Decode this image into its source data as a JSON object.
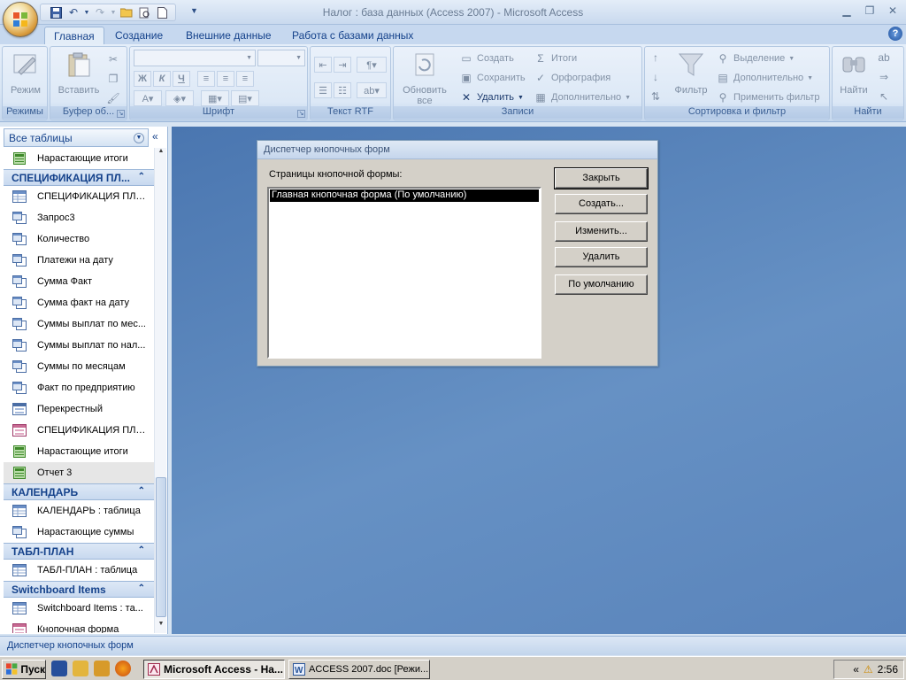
{
  "window": {
    "title": "Налог : база данных (Access 2007) - Microsoft Access"
  },
  "ribbon_tabs": [
    "Главная",
    "Создание",
    "Внешние данные",
    "Работа с базами данных"
  ],
  "ribbon": {
    "groups": {
      "modes": "Режимы",
      "clipboard": "Буфер об...",
      "font": "Шрифт",
      "rtf": "Текст RTF",
      "records": "Записи",
      "sort_filter": "Сортировка и фильтр",
      "find": "Найти"
    },
    "buttons": {
      "view": "Режим",
      "paste": "Вставить",
      "refresh": "Обновить все",
      "new": "Создать",
      "save": "Сохранить",
      "delete": "Удалить",
      "totals": "Итоги",
      "spelling": "Орфография",
      "more": "Дополнительно",
      "filter": "Фильтр",
      "selection": "Выделение",
      "advanced": "Дополнительно",
      "toggle_filter": "Применить фильтр",
      "find": "Найти"
    },
    "format": {
      "bold": "Ж",
      "italic": "К",
      "underline": "Ч"
    }
  },
  "nav": {
    "header": "Все таблицы",
    "top_item": "Нарастающие итоги",
    "groups": [
      {
        "name": "СПЕЦИФИКАЦИЯ ПЛ...",
        "items": [
          {
            "label": "СПЕЦИФИКАЦИЯ ПЛА...",
            "icon": "table-icon"
          },
          {
            "label": "Запрос3",
            "icon": "query-icon"
          },
          {
            "label": "Количество",
            "icon": "query-icon"
          },
          {
            "label": "Платежи на дату",
            "icon": "query-icon"
          },
          {
            "label": "Сумма Факт",
            "icon": "query-icon"
          },
          {
            "label": "Сумма факт на дату",
            "icon": "query-icon"
          },
          {
            "label": "Суммы выплат по мес...",
            "icon": "query-icon"
          },
          {
            "label": "Суммы выплат по нал...",
            "icon": "query-icon"
          },
          {
            "label": "Суммы по месяцам",
            "icon": "query-icon"
          },
          {
            "label": "Факт по предприятию",
            "icon": "query-icon"
          },
          {
            "label": "Перекрестный",
            "icon": "form-icon"
          },
          {
            "label": "СПЕЦИФИКАЦИЯ ПЛА...",
            "icon": "form-icon-pink"
          },
          {
            "label": "Нарастающие итоги",
            "icon": "report-icon"
          },
          {
            "label": "Отчет 3",
            "icon": "report-icon",
            "selected": true
          }
        ]
      },
      {
        "name": "КАЛЕНДАРЬ",
        "items": [
          {
            "label": "КАЛЕНДАРЬ : таблица",
            "icon": "table-icon"
          },
          {
            "label": "Нарастающие суммы",
            "icon": "query-icon"
          }
        ]
      },
      {
        "name": "ТАБЛ-ПЛАН",
        "items": [
          {
            "label": "ТАБЛ-ПЛАН : таблица",
            "icon": "table-icon"
          }
        ]
      },
      {
        "name": "Switchboard Items",
        "items": [
          {
            "label": "Switchboard Items : та...",
            "icon": "table-icon"
          },
          {
            "label": "Кнопочная форма",
            "icon": "form-icon-pink"
          }
        ]
      }
    ]
  },
  "dialog": {
    "title": "Диспетчер кнопочных форм",
    "list_label": "Страницы кнопочной формы:",
    "pages": [
      "Главная кнопочная форма (По умолчанию)"
    ],
    "buttons": {
      "close": "Закрыть",
      "create": "Создать...",
      "edit": "Изменить...",
      "delete": "Удалить",
      "default": "По умолчанию"
    }
  },
  "statusbar": {
    "text": "Диспетчер кнопочных форм"
  },
  "taskbar": {
    "start": "Пуск",
    "tasks": [
      "Microsoft Access - На...",
      "ACCESS 2007.doc [Режи..."
    ],
    "clock": "2:56"
  }
}
